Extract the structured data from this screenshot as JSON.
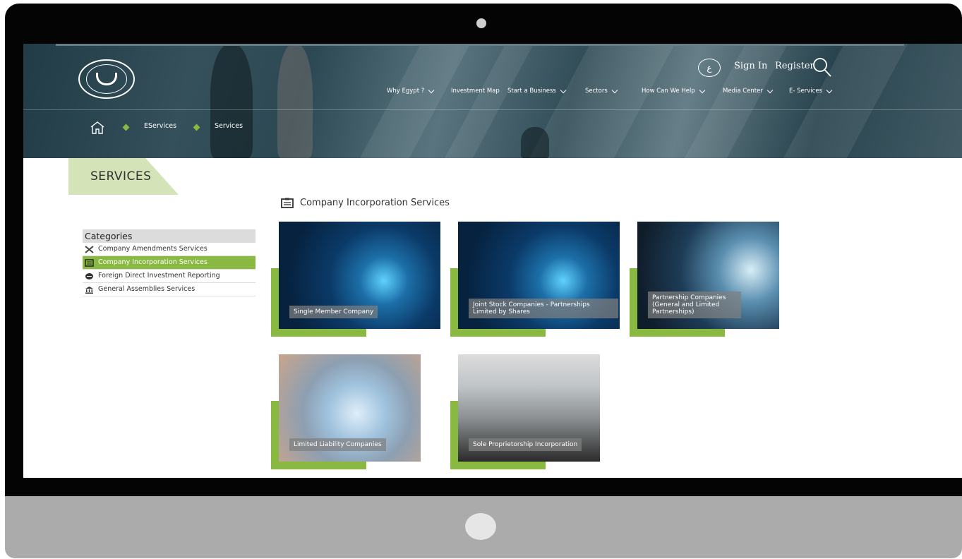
{
  "header": {
    "lang_label": "ع",
    "sign_in": "Sign In",
    "register": "Register",
    "nav": [
      "Why Egypt ?",
      "Investment Map",
      "Start a Business",
      "Sectors",
      "How Can We Help",
      "Media Center",
      "E- Services"
    ]
  },
  "breadcrumb": [
    "EServices",
    "Services"
  ],
  "page_title": "SERVICES",
  "categories": {
    "heading": "Categories",
    "items": [
      {
        "label": "Company Amendments Services",
        "icon": "tools-icon",
        "active": false
      },
      {
        "label": "Company Incorporation Services",
        "icon": "clipboard-icon",
        "active": true
      },
      {
        "label": "Foreign Direct Investment Reporting",
        "icon": "coin-icon",
        "active": false
      },
      {
        "label": "General Assemblies Services",
        "icon": "bank-icon",
        "active": false
      }
    ]
  },
  "section_title": "Company Incorporation Services",
  "cards": [
    {
      "title": "Single Member Company"
    },
    {
      "title": "Joint Stock Companies - Partnerships Limited by Shares"
    },
    {
      "title": "Partnership Companies (General and Limited Partnerships)"
    },
    {
      "title": "Limited Liability Companies"
    },
    {
      "title": "Sole Proprietorship Incorporation"
    }
  ],
  "colors": {
    "accent": "#8ab942",
    "header_bg": "#2c4a55"
  }
}
